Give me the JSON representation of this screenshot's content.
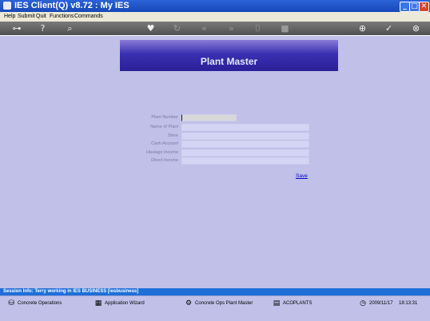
{
  "window": {
    "title": "IES Client(Q) v8.72 : My IES"
  },
  "menu": {
    "items": [
      "Help",
      "Submit",
      "Quit",
      "Functions",
      "Commands"
    ]
  },
  "toolbar": {
    "icons": [
      "key-icon",
      "help-icon",
      "search-icon",
      "heart-icon",
      "refresh-icon",
      "rewind-icon",
      "forward-icon",
      "trash-icon",
      "stop-icon",
      "globe-icon",
      "check-icon",
      "close-icon"
    ]
  },
  "form": {
    "title": "Plant Master",
    "fields": [
      {
        "label": "Plant Number",
        "value": ""
      },
      {
        "label": "Name of Plant",
        "value": ""
      },
      {
        "label": "Store",
        "value": ""
      },
      {
        "label": "Cash Account",
        "value": ""
      },
      {
        "label": "Haulage Income",
        "value": ""
      },
      {
        "label": "Direct Income",
        "value": ""
      }
    ],
    "save_label": "Save"
  },
  "status": {
    "text": "Session Info: Terry working in IES BUSINESS   [iesbusiness]"
  },
  "taskbar": {
    "items": [
      {
        "label": "Concrete Operations",
        "icon": "concrete-icon"
      },
      {
        "label": "Application Wizard",
        "icon": "wizard-icon"
      },
      {
        "label": "Concrete Ops Plant Master",
        "icon": "plant-icon"
      },
      {
        "label": "ACOPLANTS",
        "icon": "table-icon"
      }
    ],
    "date": "2009/11/17",
    "time": "18:13:31"
  },
  "colors": {
    "accent": "#2b63d8",
    "banner": "#3a2fb0",
    "background": "#c0c0e8"
  }
}
